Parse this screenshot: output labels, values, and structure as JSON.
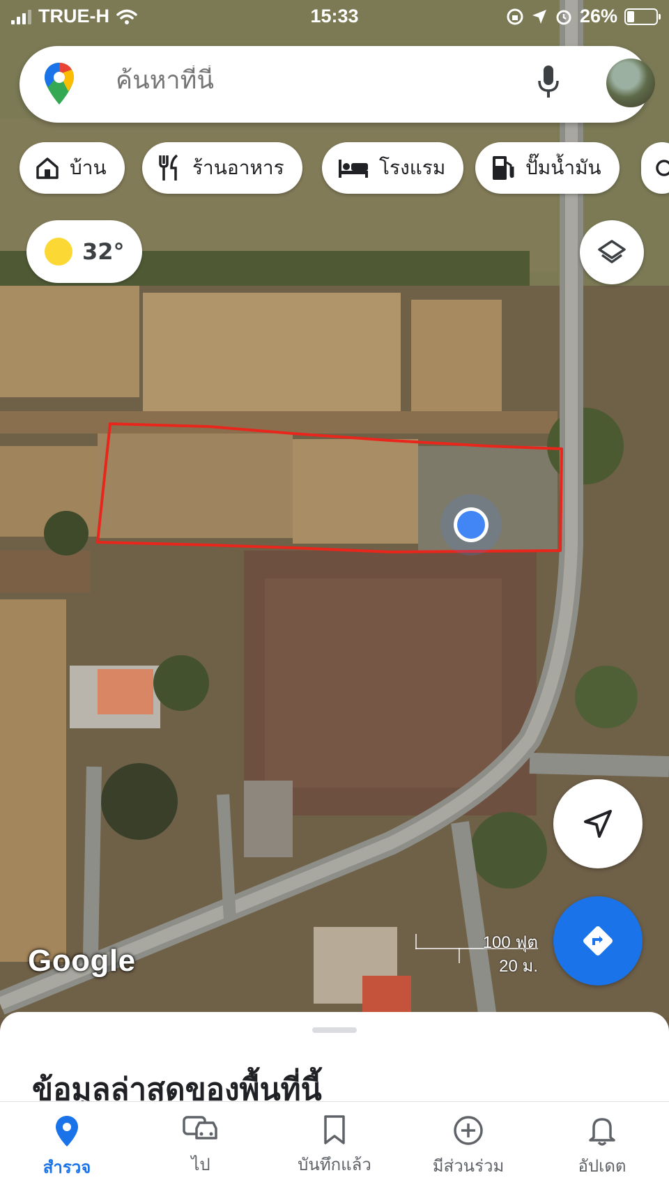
{
  "status_bar": {
    "carrier": "TRUE-H",
    "time": "15:33",
    "battery": "26%"
  },
  "search": {
    "placeholder": "ค้นหาที่นี่"
  },
  "chips": [
    {
      "label": "บ้าน",
      "icon": "home-icon"
    },
    {
      "label": "ร้านอาหาร",
      "icon": "restaurant-icon"
    },
    {
      "label": "โรงแรม",
      "icon": "hotel-icon"
    },
    {
      "label": "ปั๊มน้ำมัน",
      "icon": "gas-station-icon"
    }
  ],
  "weather": {
    "temperature": "32°",
    "icon": "sun-icon"
  },
  "map": {
    "attribution": "Google",
    "scale_imperial": "100 ฟุต",
    "scale_metric": "20 ม.",
    "marker_color": "#e8261c",
    "location_dot_color": "#4285f4"
  },
  "sheet": {
    "title": "ข้อมูลล่าสุดของพื้นที่นี้"
  },
  "tabs": [
    {
      "label": "สำรวจ",
      "icon": "location-pin-icon",
      "active": true
    },
    {
      "label": "ไป",
      "icon": "car-icon",
      "active": false
    },
    {
      "label": "บันทึกแล้ว",
      "icon": "bookmark-icon",
      "active": false
    },
    {
      "label": "มีส่วนร่วม",
      "icon": "add-circle-icon",
      "active": false
    },
    {
      "label": "อัปเดต",
      "icon": "bell-icon",
      "active": false
    }
  ],
  "colors": {
    "accent": "#1a73e8",
    "annotation": "#e8261c"
  }
}
